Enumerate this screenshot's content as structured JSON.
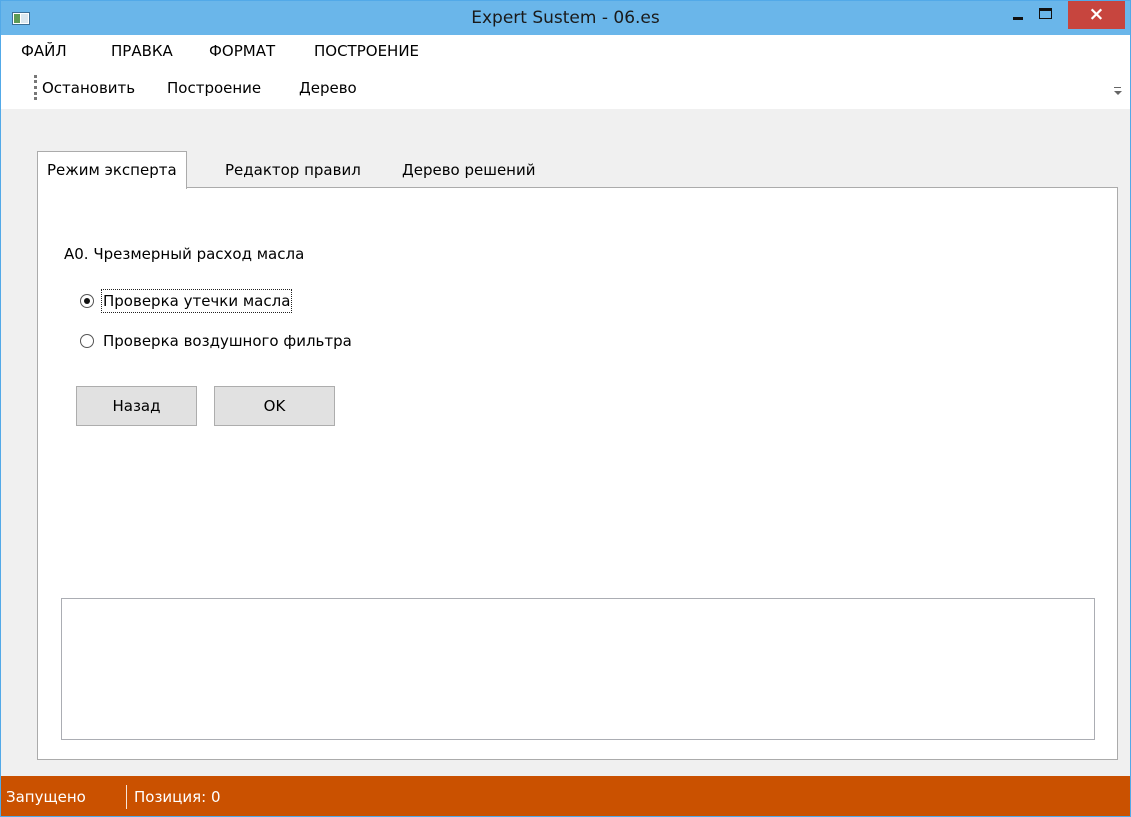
{
  "window": {
    "title": "Expert Sustem - 06.es",
    "controls": {
      "minimize": "minimize",
      "maximize": "maximize",
      "close": "×"
    }
  },
  "menubar": {
    "items": [
      {
        "label": "ФАЙЛ"
      },
      {
        "label": "ПРАВКА"
      },
      {
        "label": "ФОРМАТ"
      },
      {
        "label": "ПОСТРОЕНИЕ"
      }
    ]
  },
  "toolbar": {
    "items": [
      {
        "label": "Остановить"
      },
      {
        "label": "Построение"
      },
      {
        "label": "Дерево"
      }
    ]
  },
  "tabs": {
    "items": [
      {
        "label": "Режим эксперта",
        "active": true
      },
      {
        "label": "Редактор правил",
        "active": false
      },
      {
        "label": "Дерево решений",
        "active": false
      }
    ]
  },
  "panel": {
    "question": "А0. Чрезмерный расход масла",
    "options": [
      {
        "label": "Проверка утечки масла",
        "checked": true
      },
      {
        "label": "Проверка воздушного фильтра",
        "checked": false
      }
    ],
    "buttons": {
      "back": "Назад",
      "ok": "OK"
    },
    "output_text": ""
  },
  "statusbar": {
    "state": "Запущено",
    "position": "Позиция: 0"
  },
  "colors": {
    "titlebar": "#6ab6ea",
    "close_button": "#c7453e",
    "statusbar": "#ca5100"
  }
}
